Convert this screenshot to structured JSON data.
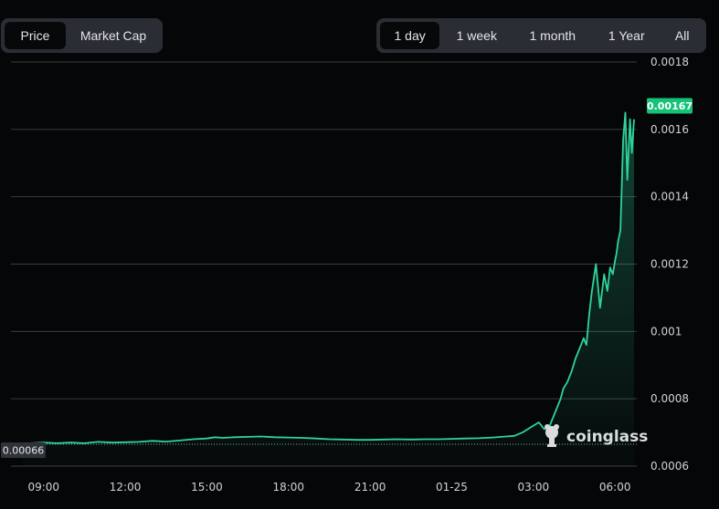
{
  "tabs": {
    "metric": [
      {
        "label": "Price",
        "active": true
      },
      {
        "label": "Market Cap",
        "active": false
      }
    ],
    "range": [
      {
        "label": "1 day",
        "active": true
      },
      {
        "label": "1 week",
        "active": false
      },
      {
        "label": "1 month",
        "active": false
      },
      {
        "label": "1 Year",
        "active": false
      },
      {
        "label": "All",
        "active": false
      }
    ]
  },
  "watermark": "coinglass",
  "colors": {
    "line": "#2fd49b",
    "badge_current": "#15c278",
    "badge_start": "#2f3338",
    "grid": "#3a3d42",
    "background": "#050608"
  },
  "chart_data": {
    "type": "area",
    "ylim": [
      0.0006,
      0.0018
    ],
    "y_ticks": [
      "0.0006",
      "0.0008",
      "0.001",
      "0.0012",
      "0.0014",
      "0.0016",
      "0.0018"
    ],
    "x_ticks": [
      "09:00",
      "12:00",
      "15:00",
      "18:00",
      "21:00",
      "01-25",
      "03:00",
      "06:00"
    ],
    "current_label": "0.00167",
    "start_label": "0.00066",
    "series": [
      {
        "x": [
          8.2,
          8.5,
          9,
          9.5,
          10,
          10.5,
          11,
          11.5,
          12,
          12.5,
          13,
          13.5,
          14,
          14.5,
          15,
          15.3,
          15.6,
          16,
          16.5,
          17,
          17.5,
          18,
          18.5,
          19,
          19.5,
          20,
          20.5,
          21,
          21.5,
          22,
          22.5,
          23,
          23.5,
          24,
          24.5,
          25,
          25.5,
          26,
          26.3,
          26.6,
          26.9,
          27.2,
          27.4,
          27.6,
          27.8,
          28.0,
          28.1,
          28.25,
          28.4,
          28.55,
          28.7,
          28.85,
          28.95,
          29.05,
          29.15,
          29.3,
          29.45,
          29.6,
          29.72,
          29.82,
          29.92,
          30.0,
          30.05,
          30.12,
          30.2,
          30.3,
          30.38,
          30.45,
          30.55,
          30.62,
          30.7
        ],
        "y": [
          0.000665,
          0.000668,
          0.00067,
          0.000668,
          0.00067,
          0.000668,
          0.000672,
          0.00067,
          0.000671,
          0.000672,
          0.000675,
          0.000673,
          0.000676,
          0.00068,
          0.000682,
          0.000686,
          0.000684,
          0.000686,
          0.000687,
          0.000688,
          0.000686,
          0.000685,
          0.000684,
          0.000682,
          0.00068,
          0.000679,
          0.000678,
          0.000678,
          0.000679,
          0.00068,
          0.000679,
          0.00068,
          0.00068,
          0.000681,
          0.000682,
          0.000683,
          0.000685,
          0.000688,
          0.00069,
          0.0007,
          0.000715,
          0.00073,
          0.00071,
          0.00072,
          0.00076,
          0.0008,
          0.00083,
          0.00085,
          0.00088,
          0.00092,
          0.00095,
          0.00098,
          0.00096,
          0.00105,
          0.00112,
          0.0012,
          0.00107,
          0.00117,
          0.00112,
          0.00119,
          0.00117,
          0.00121,
          0.00123,
          0.00127,
          0.0013,
          0.00157,
          0.00165,
          0.00145,
          0.00163,
          0.00153,
          0.00163
        ]
      }
    ]
  }
}
